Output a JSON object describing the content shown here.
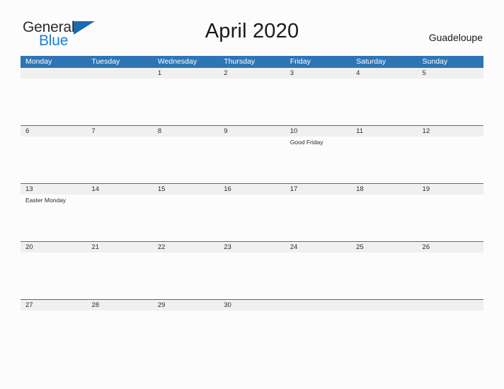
{
  "brand": {
    "name_top": "General",
    "name_bottom": "Blue",
    "flag_icon": "blue-triangle-flag-icon",
    "color_top": "#2b2b2b",
    "color_bottom": "#1e7fd0",
    "flag_color": "#1b6ab0"
  },
  "header": {
    "title": "April 2020",
    "region": "Guadeloupe"
  },
  "theme": {
    "header_blue": "#2e75b6",
    "date_band_gray": "#f0f0f0",
    "page_background": "#fcfcfd",
    "separator_blue": "#2e75b6",
    "text_dark": "#2b2b2b"
  },
  "calendar": {
    "weekdays": [
      "Monday",
      "Tuesday",
      "Wednesday",
      "Thursday",
      "Friday",
      "Saturday",
      "Sunday"
    ],
    "weeks": [
      {
        "days": [
          {
            "date": "",
            "event": ""
          },
          {
            "date": "",
            "event": ""
          },
          {
            "date": "1",
            "event": ""
          },
          {
            "date": "2",
            "event": ""
          },
          {
            "date": "3",
            "event": ""
          },
          {
            "date": "4",
            "event": ""
          },
          {
            "date": "5",
            "event": ""
          }
        ]
      },
      {
        "days": [
          {
            "date": "6",
            "event": ""
          },
          {
            "date": "7",
            "event": ""
          },
          {
            "date": "8",
            "event": ""
          },
          {
            "date": "9",
            "event": ""
          },
          {
            "date": "10",
            "event": "Good Friday"
          },
          {
            "date": "11",
            "event": ""
          },
          {
            "date": "12",
            "event": ""
          }
        ]
      },
      {
        "days": [
          {
            "date": "13",
            "event": "Easter Monday"
          },
          {
            "date": "14",
            "event": ""
          },
          {
            "date": "15",
            "event": ""
          },
          {
            "date": "16",
            "event": ""
          },
          {
            "date": "17",
            "event": ""
          },
          {
            "date": "18",
            "event": ""
          },
          {
            "date": "19",
            "event": ""
          }
        ]
      },
      {
        "days": [
          {
            "date": "20",
            "event": ""
          },
          {
            "date": "21",
            "event": ""
          },
          {
            "date": "22",
            "event": ""
          },
          {
            "date": "23",
            "event": ""
          },
          {
            "date": "24",
            "event": ""
          },
          {
            "date": "25",
            "event": ""
          },
          {
            "date": "26",
            "event": ""
          }
        ]
      },
      {
        "days": [
          {
            "date": "27",
            "event": ""
          },
          {
            "date": "28",
            "event": ""
          },
          {
            "date": "29",
            "event": ""
          },
          {
            "date": "30",
            "event": ""
          },
          {
            "date": "",
            "event": ""
          },
          {
            "date": "",
            "event": ""
          },
          {
            "date": "",
            "event": ""
          }
        ]
      }
    ]
  }
}
